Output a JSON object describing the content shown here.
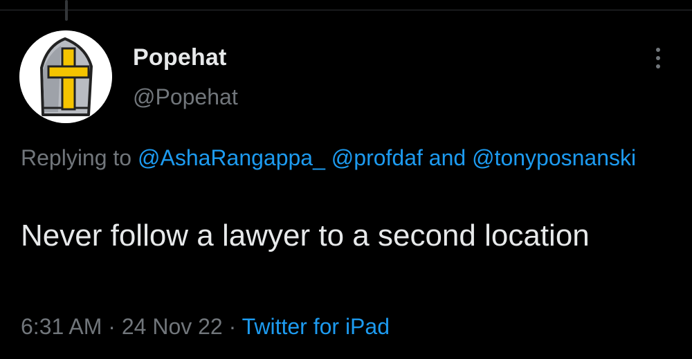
{
  "tweet": {
    "display_name": "Popehat",
    "handle": "@Popehat",
    "replying_prefix": "Replying to",
    "mentions": [
      "@AshaRangappa_",
      "@profdaf",
      "@tonyposnanski"
    ],
    "mention_connector": "and",
    "text": "Never follow a lawyer to a second location",
    "time": "6:31 AM",
    "separator": "·",
    "date": "24 Nov 22",
    "source": "Twitter for iPad"
  },
  "icons": {
    "more": "more-vertical-icon",
    "avatar": "papal-mitre-avatar"
  },
  "colors": {
    "background": "#000000",
    "primary_text": "#e7e9ea",
    "secondary_text": "#71767b",
    "link": "#1d9bf0",
    "avatar_cross": "#f5c400"
  }
}
